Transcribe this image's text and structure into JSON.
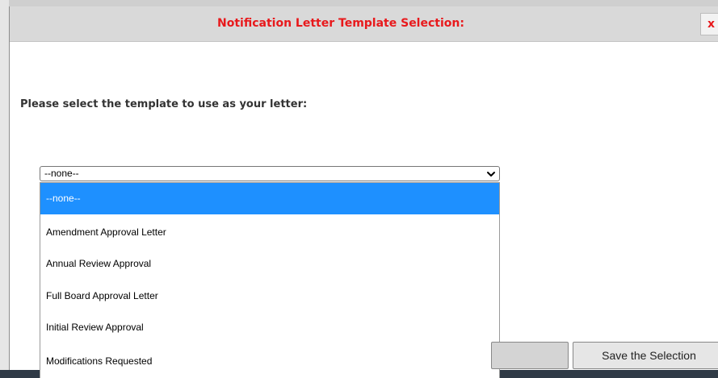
{
  "modal": {
    "title": "Notification Letter Template Selection:",
    "close_label": "x",
    "prompt": "Please select the template to use as your letter:"
  },
  "template_select": {
    "selected_value": "--none--",
    "options": [
      "--none--",
      "Amendment Approval Letter",
      "Annual Review Approval",
      "Full Board Approval Letter",
      "Initial Review Approval",
      "Modifications Requested"
    ]
  },
  "buttons": {
    "left_label": "",
    "save_label": "Save the Selection"
  },
  "colors": {
    "title": "#e8191c",
    "highlight": "#1e90ff"
  }
}
